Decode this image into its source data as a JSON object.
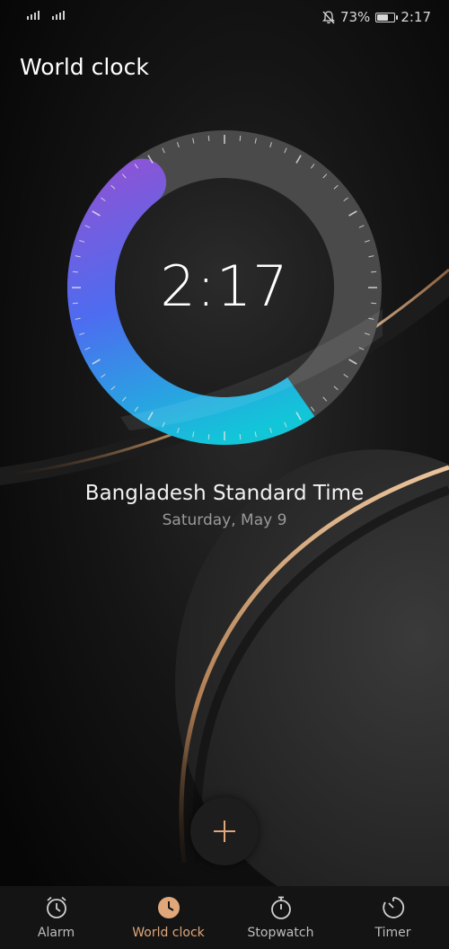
{
  "status": {
    "battery_percent_label": "73%",
    "battery_level": 0.73,
    "time": "2:17"
  },
  "header": {
    "title": "World clock"
  },
  "clock": {
    "time": "2:17",
    "zone_name": "Bangladesh Standard Time",
    "date": "Saturday, May 9"
  },
  "fab": {
    "icon": "plus-icon"
  },
  "tabs": [
    {
      "label": "Alarm",
      "icon": "alarm-icon",
      "active": false
    },
    {
      "label": "World clock",
      "icon": "clock-icon",
      "active": true
    },
    {
      "label": "Stopwatch",
      "icon": "stopwatch-icon",
      "active": false
    },
    {
      "label": "Timer",
      "icon": "timer-icon",
      "active": false
    }
  ],
  "colors": {
    "accent": "#e0a77b",
    "arc_start": "#8a55d6",
    "arc_mid": "#4d6cf0",
    "arc_end": "#12c6d8",
    "tab_bar": "#141414"
  }
}
